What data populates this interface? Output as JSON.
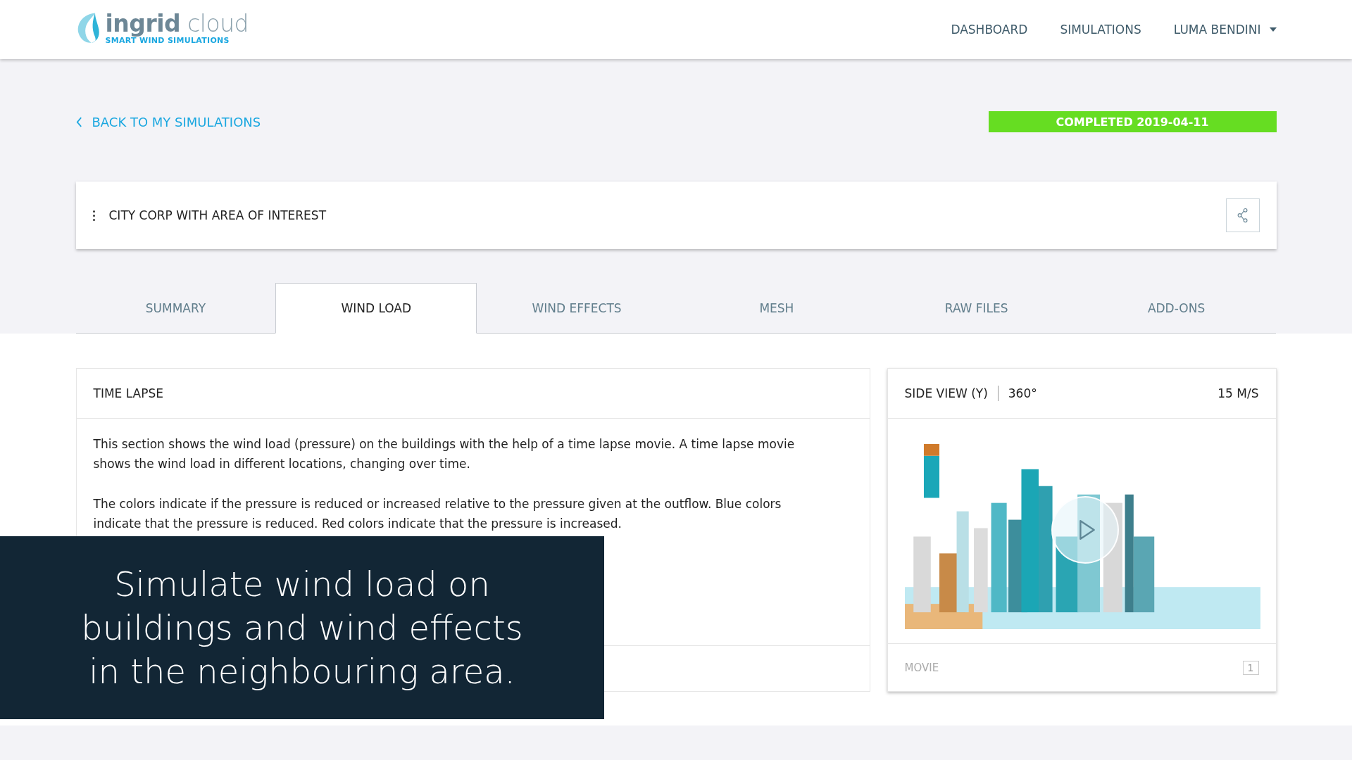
{
  "header": {
    "logo": {
      "name": "ingrid",
      "suffix": "cloud",
      "tagline": "SMART WIND SIMULATIONS"
    },
    "nav": [
      {
        "label": "DASHBOARD",
        "kind": "link"
      },
      {
        "label": "SIMULATIONS",
        "kind": "link"
      },
      {
        "label": "LUMA BENDINI",
        "kind": "menu"
      }
    ]
  },
  "back_link": "BACK TO MY SIMULATIONS",
  "status_badge": {
    "label": "COMPLETED 2019-04-11",
    "color": "#66dd22"
  },
  "simulation": {
    "title": "CITY CORP WITH AREA OF INTEREST"
  },
  "tabs": [
    {
      "label": "SUMMARY",
      "selected": false
    },
    {
      "label": "WIND LOAD",
      "selected": true
    },
    {
      "label": "WIND EFFECTS",
      "selected": false
    },
    {
      "label": "MESH",
      "selected": false
    },
    {
      "label": "RAW FILES",
      "selected": false
    },
    {
      "label": "ADD-ONS",
      "selected": false
    }
  ],
  "time_lapse": {
    "title": "TIME LAPSE",
    "paragraphs": [
      "This section shows the wind load (pressure) on the buildings with the help of a time lapse movie. A time lapse movie shows the wind load in different locations, changing over time.",
      "The colors indicate if the pressure is reduced or increased relative to the pressure given at the outflow. Blue colors indicate that the pressure is reduced. Red colors indicate that the pressure is increased."
    ]
  },
  "movie_card": {
    "view": "SIDE VIEW (Y)",
    "angle": "360°",
    "speed": "15 M/S",
    "footer_label": "MOVIE",
    "count": "1"
  },
  "caption_overlay": {
    "lines": [
      "Simulate wind load on",
      "buildings and wind effects",
      "in the neighbouring area."
    ]
  }
}
